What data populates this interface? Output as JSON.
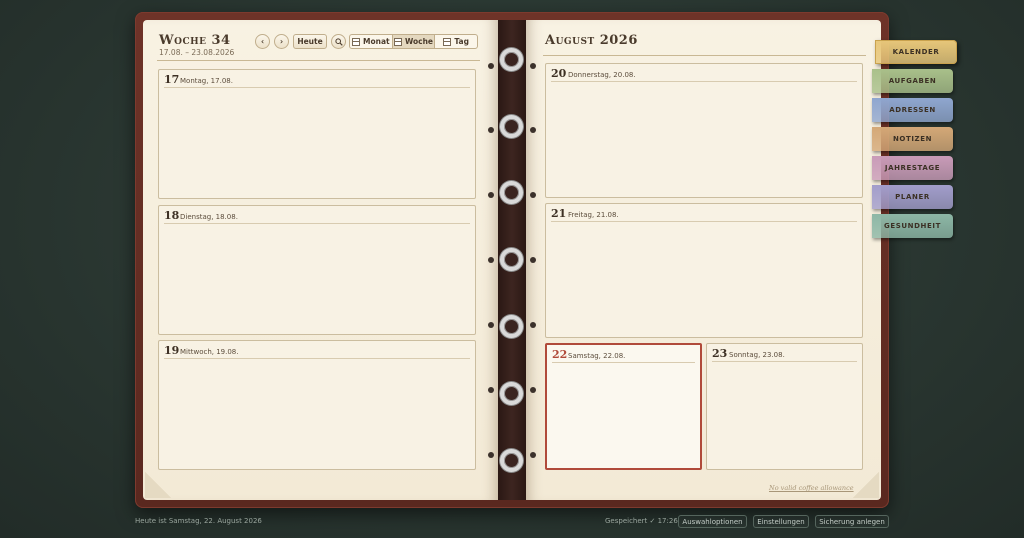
{
  "left_header": {
    "week_title": "Woche 34",
    "week_range": "17.08. – 23.08.2026",
    "prev_label": "‹",
    "next_label": "›",
    "today_label": "Heute",
    "search_icon": "magnifier-icon",
    "views": [
      {
        "label": "Monat",
        "active": false
      },
      {
        "label": "Woche",
        "active": true
      },
      {
        "label": "Tag",
        "active": false
      }
    ]
  },
  "right_header": {
    "month_title": "August 2026"
  },
  "days": [
    {
      "num": "17",
      "name": "Montag, 17.08.",
      "today": false
    },
    {
      "num": "18",
      "name": "Dienstag, 18.08.",
      "today": false
    },
    {
      "num": "19",
      "name": "Mittwoch, 19.08.",
      "today": false
    },
    {
      "num": "20",
      "name": "Donnerstag, 20.08.",
      "today": false
    },
    {
      "num": "21",
      "name": "Freitag, 21.08.",
      "today": false
    },
    {
      "num": "22",
      "name": "Samstag, 22.08.",
      "today": true
    },
    {
      "num": "23",
      "name": "Sonntag, 23.08.",
      "today": false
    }
  ],
  "footer_note": "No valid coffee allowance",
  "tabs": [
    {
      "label": "KALENDER",
      "color": "#e8c77a",
      "active": true
    },
    {
      "label": "AUFGABEN",
      "color": "#a9c08a",
      "active": false
    },
    {
      "label": "ADRESSEN",
      "color": "#8fa6cf",
      "active": false
    },
    {
      "label": "NOTIZEN",
      "color": "#d4a877",
      "active": false
    },
    {
      "label": "JAHRESTAGE",
      "color": "#c99bb8",
      "active": false
    },
    {
      "label": "PLANER",
      "color": "#a29dcb",
      "active": false
    },
    {
      "label": "GESUNDHEIT",
      "color": "#8db7a6",
      "active": false
    }
  ],
  "status_bar": {
    "today_text": "Heute ist Samstag, 22. August 2026",
    "saved_text": "Gespeichert ✓ 17:26",
    "options_label": "Auswahloptionen",
    "settings_label": "Einstellungen",
    "backup_label": "Sicherung anlegen"
  }
}
